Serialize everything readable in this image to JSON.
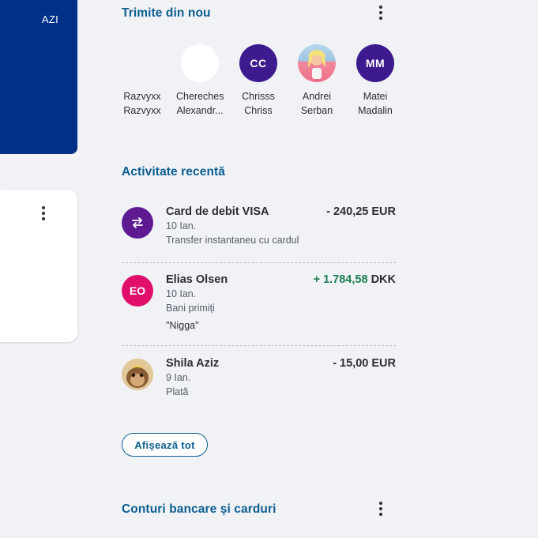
{
  "left": {
    "today_label": "AZI"
  },
  "send_again": {
    "title": "Trimite din nou",
    "contacts": [
      {
        "line1": "Razvyxx",
        "line2": "Razvyxx",
        "initials": "",
        "color": ""
      },
      {
        "line1": "Chereches",
        "line2": "Alexandr...",
        "initials": "",
        "color": ""
      },
      {
        "line1": "Chrisss",
        "line2": "Chriss",
        "initials": "CC",
        "color": "#3d1b8f"
      },
      {
        "line1": "Andrei",
        "line2": "Serban",
        "initials": "",
        "color": ""
      },
      {
        "line1": "Matei",
        "line2": "Madalin",
        "initials": "MM",
        "color": "#3d1b8f"
      }
    ]
  },
  "recent": {
    "title": "Activitate recentă",
    "items": [
      {
        "name": "Card de debit VISA",
        "date": "10 Ian.",
        "desc": "Transfer instantaneu cu cardul",
        "note": "",
        "amount": "- 240,25 EUR",
        "amount_value": "",
        "amount_currency": "",
        "icon": "transfer-icon",
        "color": "#5e1a91"
      },
      {
        "name": "Elias Olsen",
        "date": "10 Ian.",
        "desc": "Bani primiți",
        "note": "\"Nigga\"",
        "amount": "",
        "amount_value": "+ 1.784,58",
        "amount_currency": " DKK",
        "initials": "EO",
        "color": "#e0106a"
      },
      {
        "name": "Shila Aziz",
        "date": "9 Ian.",
        "desc": "Plată",
        "note": "",
        "amount": "- 15,00 EUR",
        "amount_value": "",
        "amount_currency": "",
        "icon": "monkey-avatar",
        "color": "#c8a36f"
      }
    ],
    "show_all": "Afișează tot"
  },
  "banks": {
    "title": "Conturi bancare și carduri"
  }
}
